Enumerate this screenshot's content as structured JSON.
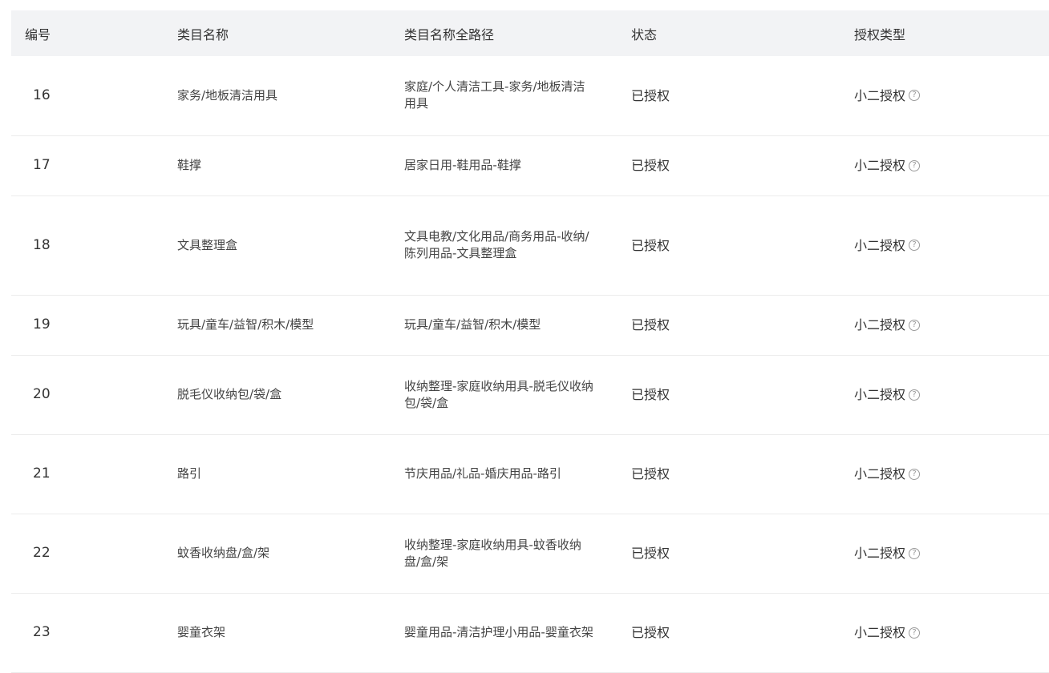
{
  "table": {
    "headers": {
      "id": "编号",
      "name": "类目名称",
      "path": "类目名称全路径",
      "status": "状态",
      "auth_type": "授权类型"
    },
    "rows": [
      {
        "id": "16",
        "name": "家务/地板清洁用具",
        "path": "家庭/个人清洁工具-家务/地板清洁用具",
        "status": "已授权",
        "auth_type": "小二授权"
      },
      {
        "id": "17",
        "name": "鞋撑",
        "path": "居家日用-鞋用品-鞋撑",
        "status": "已授权",
        "auth_type": "小二授权"
      },
      {
        "id": "18",
        "name": "文具整理盒",
        "path": "文具电教/文化用品/商务用品-收纳/陈列用品-文具整理盒",
        "status": "已授权",
        "auth_type": "小二授权"
      },
      {
        "id": "19",
        "name": "玩具/童车/益智/积木/模型",
        "path": "玩具/童车/益智/积木/模型",
        "status": "已授权",
        "auth_type": "小二授权"
      },
      {
        "id": "20",
        "name": "脱毛仪收纳包/袋/盒",
        "path": "收纳整理-家庭收纳用具-脱毛仪收纳包/袋/盒",
        "status": "已授权",
        "auth_type": "小二授权"
      },
      {
        "id": "21",
        "name": "路引",
        "path": "节庆用品/礼品-婚庆用品-路引",
        "status": "已授权",
        "auth_type": "小二授权"
      },
      {
        "id": "22",
        "name": "蚊香收纳盘/盒/架",
        "path": "收纳整理-家庭收纳用具-蚊香收纳盘/盒/架",
        "status": "已授权",
        "auth_type": "小二授权"
      },
      {
        "id": "23",
        "name": "婴童衣架",
        "path": "婴童用品-清洁护理小用品-婴童衣架",
        "status": "已授权",
        "auth_type": "小二授权"
      }
    ]
  },
  "icons": {
    "help": "question-circle-icon"
  },
  "colors": {
    "header_bg": "#f2f3f5",
    "row_border": "#ececec",
    "text": "#333333",
    "icon": "#9a9a9a"
  }
}
